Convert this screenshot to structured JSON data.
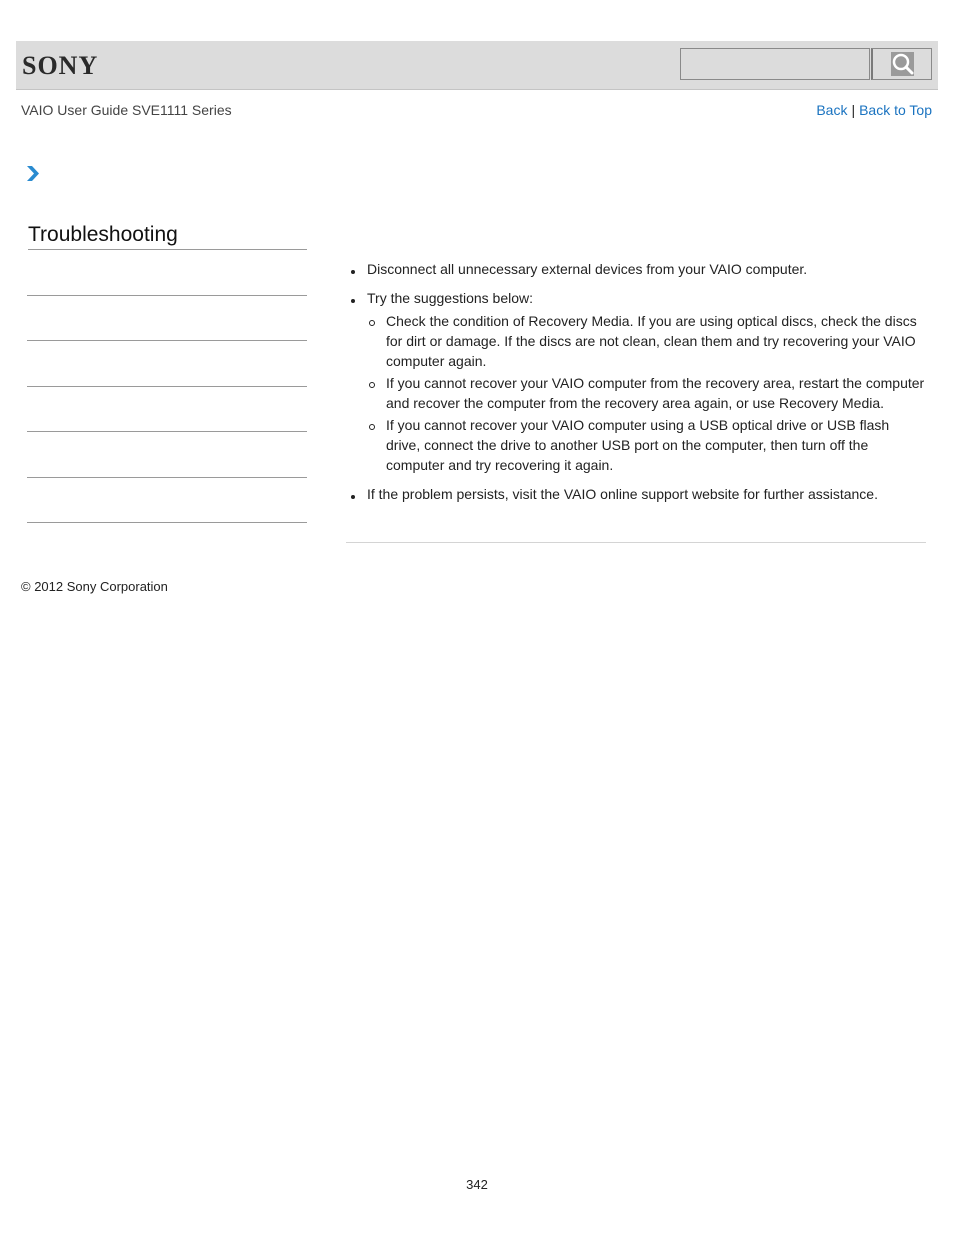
{
  "header": {
    "logo": "SONY",
    "search": {
      "value": "",
      "placeholder": ""
    },
    "search_icon": "magnifier-icon"
  },
  "subheader": {
    "guide_title": "VAIO User Guide SVE1111 Series",
    "back_label": "Back",
    "separator": "|",
    "back_to_top_label": "Back to Top"
  },
  "breadcrumb": {
    "icon": "chevron-right-icon"
  },
  "sidebar": {
    "title": "Troubleshooting",
    "items": [
      "",
      "",
      "",
      "",
      "",
      ""
    ]
  },
  "content": {
    "items": [
      {
        "text": "Disconnect all unnecessary external devices from your VAIO computer."
      },
      {
        "text": "Try the suggestions below:",
        "subitems": [
          "Check the condition of Recovery Media. If you are using optical discs, check the discs for dirt or damage. If the discs are not clean, clean them and try recovering your VAIO computer again.",
          "If you cannot recover your VAIO computer from the recovery area, restart the computer and recover the computer from the recovery area again, or use Recovery Media.",
          "If you cannot recover your VAIO computer using a USB optical drive or USB flash drive, connect the drive to another USB port on the computer, then turn off the computer and try recovering it again."
        ]
      },
      {
        "text": "If the problem persists, visit the VAIO online support website for further assistance."
      }
    ]
  },
  "footer": {
    "copyright": "© 2012 Sony Corporation",
    "page_number": "342"
  },
  "colors": {
    "header_bg": "#dcdcdc",
    "link": "#1a73c0",
    "chevron": "#2a8bd0"
  }
}
